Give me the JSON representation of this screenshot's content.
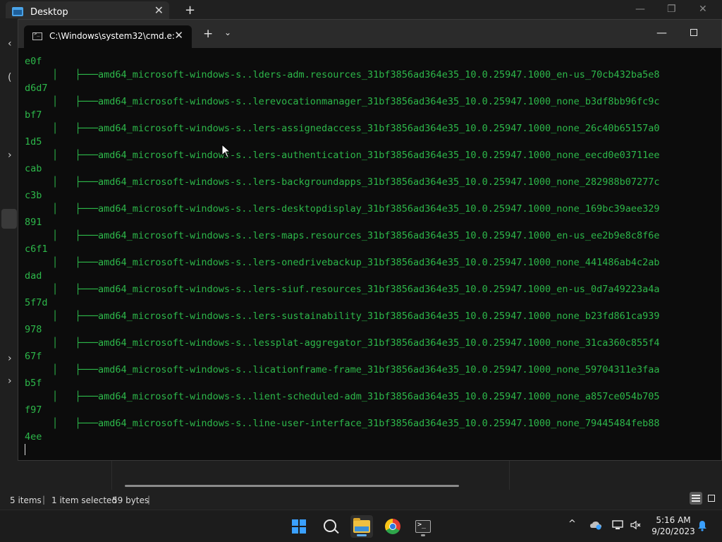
{
  "explorer": {
    "tab_title": "Desktop",
    "tab_close": "✕",
    "new_tab": "+",
    "minimize": "—",
    "restore": "❐",
    "close": "✕",
    "status_items": "5 items",
    "status_selected": "1 item selected",
    "status_size": "59 bytes"
  },
  "terminal": {
    "tab_title": "C:\\Windows\\system32\\cmd.e:",
    "tab_close": "✕",
    "new_tab": "+",
    "dropdown": "⌄",
    "minimize": "—",
    "tree_prefix": "│   ├───",
    "lines": [
      {
        "hash": "e0f",
        "entry": "amd64_microsoft-windows-s..lders-adm.resources_31bf3856ad364e35_10.0.25947.1000_en-us_70cb432ba5e8"
      },
      {
        "hash": "d6d7",
        "entry": "amd64_microsoft-windows-s..lerevocationmanager_31bf3856ad364e35_10.0.25947.1000_none_b3df8bb96fc9c"
      },
      {
        "hash": "bf7",
        "entry": "amd64_microsoft-windows-s..lers-assignedaccess_31bf3856ad364e35_10.0.25947.1000_none_26c40b65157a0"
      },
      {
        "hash": "1d5",
        "entry": "amd64_microsoft-windows-s..lers-authentication_31bf3856ad364e35_10.0.25947.1000_none_eecd0e03711ee"
      },
      {
        "hash": "cab",
        "entry": "amd64_microsoft-windows-s..lers-backgroundapps_31bf3856ad364e35_10.0.25947.1000_none_282988b07277c"
      },
      {
        "hash": "c3b",
        "entry": "amd64_microsoft-windows-s..lers-desktopdisplay_31bf3856ad364e35_10.0.25947.1000_none_169bc39aee329"
      },
      {
        "hash": "891",
        "entry": "amd64_microsoft-windows-s..lers-maps.resources_31bf3856ad364e35_10.0.25947.1000_en-us_ee2b9e8c8f6e"
      },
      {
        "hash": "c6f1",
        "entry": "amd64_microsoft-windows-s..lers-onedrivebackup_31bf3856ad364e35_10.0.25947.1000_none_441486ab4c2ab"
      },
      {
        "hash": "dad",
        "entry": "amd64_microsoft-windows-s..lers-siuf.resources_31bf3856ad364e35_10.0.25947.1000_en-us_0d7a49223a4a"
      },
      {
        "hash": "5f7d",
        "entry": "amd64_microsoft-windows-s..lers-sustainability_31bf3856ad364e35_10.0.25947.1000_none_b23fd861ca939"
      },
      {
        "hash": "978",
        "entry": "amd64_microsoft-windows-s..lessplat-aggregator_31bf3856ad364e35_10.0.25947.1000_none_31ca360c855f4"
      },
      {
        "hash": "67f",
        "entry": "amd64_microsoft-windows-s..licationframe-frame_31bf3856ad364e35_10.0.25947.1000_none_59704311e3faa"
      },
      {
        "hash": "b5f",
        "entry": "amd64_microsoft-windows-s..lient-scheduled-adm_31bf3856ad364e35_10.0.25947.1000_none_a857ce054b705"
      },
      {
        "hash": "f97",
        "entry": "amd64_microsoft-windows-s..line-user-interface_31bf3856ad364e35_10.0.25947.1000_none_79445484feb88"
      }
    ],
    "last_hash": "4ee"
  },
  "taskbar": {
    "time": "5:16 AM",
    "date": "9/20/2023",
    "tray_chevron": "^"
  },
  "colors": {
    "terminal_text": "#2db84a",
    "accent": "#60b0f0"
  }
}
